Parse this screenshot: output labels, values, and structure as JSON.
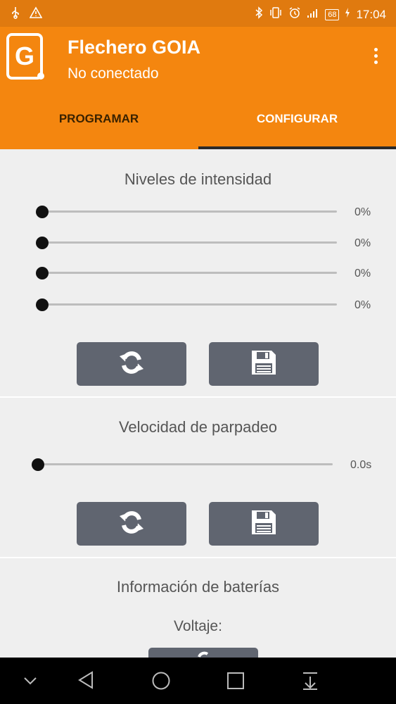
{
  "status_bar": {
    "left_icons": [
      "usb-icon",
      "warning-icon"
    ],
    "right_icons": [
      "bluetooth-icon",
      "vibrate-icon",
      "alarm-icon",
      "signal-icon"
    ],
    "battery_level": "68",
    "time": "17:04"
  },
  "app_bar": {
    "logo_letter": "G",
    "title": "Flechero GOIA",
    "subtitle": "No conectado",
    "menu_icon": "overflow-menu-icon"
  },
  "tabs": [
    {
      "label": "PROGRAMAR",
      "selected": false
    },
    {
      "label": "CONFIGURAR",
      "selected": true
    }
  ],
  "intensity_section": {
    "title": "Niveles de intensidad",
    "sliders": [
      {
        "value": 0,
        "label": "0%"
      },
      {
        "value": 0,
        "label": "0%"
      },
      {
        "value": 0,
        "label": "0%"
      },
      {
        "value": 0,
        "label": "0%"
      }
    ],
    "refresh_icon": "refresh-icon",
    "save_icon": "save-icon"
  },
  "blink_section": {
    "title": "Velocidad de parpadeo",
    "slider": {
      "value": 0,
      "label": "0.0s"
    },
    "refresh_icon": "refresh-icon",
    "save_icon": "save-icon"
  },
  "battery_section": {
    "title": "Información de baterías",
    "voltage_label": "Voltaje:"
  },
  "colors": {
    "status_bar": "#e07a0f",
    "app_bar": "#f4860f",
    "button": "#606570",
    "background": "#efefef"
  }
}
